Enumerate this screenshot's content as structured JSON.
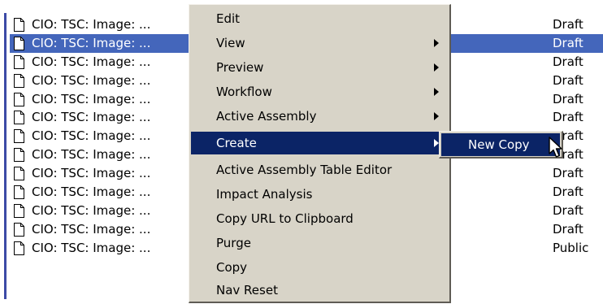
{
  "list": {
    "rows": [
      {
        "name": "CIO: TSC: Image: ...",
        "status": "Draft",
        "selected": false
      },
      {
        "name": "CIO: TSC: Image: ...",
        "status": "Draft",
        "selected": true
      },
      {
        "name": "CIO: TSC: Image: ...",
        "status": "Draft",
        "selected": false
      },
      {
        "name": "CIO: TSC: Image: ...",
        "status": "Draft",
        "selected": false
      },
      {
        "name": "CIO: TSC: Image: ...",
        "status": "Draft",
        "selected": false
      },
      {
        "name": "CIO: TSC: Image: ...",
        "status": "Draft",
        "selected": false
      },
      {
        "name": "CIO: TSC: Image: ...",
        "status": "Draft",
        "selected": false
      },
      {
        "name": "CIO: TSC: Image: ...",
        "status": "Draft",
        "selected": false
      },
      {
        "name": "CIO: TSC: Image: ...",
        "status": "Draft",
        "selected": false
      },
      {
        "name": "CIO: TSC: Image: ...",
        "status": "Draft",
        "selected": false
      },
      {
        "name": "CIO: TSC: Image: ...",
        "status": "Draft",
        "selected": false
      },
      {
        "name": "CIO: TSC: Image: ...",
        "status": "Draft",
        "selected": false
      },
      {
        "name": "CIO: TSC: Image: ...",
        "status": "Public",
        "selected": false
      }
    ],
    "row_icon": "document-icon"
  },
  "context_menu": {
    "items": [
      {
        "label": "Edit",
        "submenu": false,
        "active": false
      },
      {
        "label": "View",
        "submenu": true,
        "active": false
      },
      {
        "label": "Preview",
        "submenu": true,
        "active": false
      },
      {
        "label": "Workflow",
        "submenu": true,
        "active": false
      },
      {
        "label": "Active Assembly",
        "submenu": true,
        "active": false
      },
      {
        "label": "Create",
        "submenu": true,
        "active": true
      },
      {
        "label": "Active Assembly Table Editor",
        "submenu": false,
        "active": false
      },
      {
        "label": "Impact Analysis",
        "submenu": false,
        "active": false
      },
      {
        "label": "Copy URL to Clipboard",
        "submenu": false,
        "active": false
      },
      {
        "label": "Purge",
        "submenu": false,
        "active": false
      },
      {
        "label": "Copy",
        "submenu": false,
        "active": false
      },
      {
        "label": "Nav Reset",
        "submenu": false,
        "active": false
      }
    ]
  },
  "create_submenu": {
    "items": [
      {
        "label": "New Copy",
        "active": true
      }
    ]
  },
  "colors": {
    "selection": "#4466bb",
    "menu_background": "#d8d4c8",
    "menu_highlight": "#0b2466"
  }
}
